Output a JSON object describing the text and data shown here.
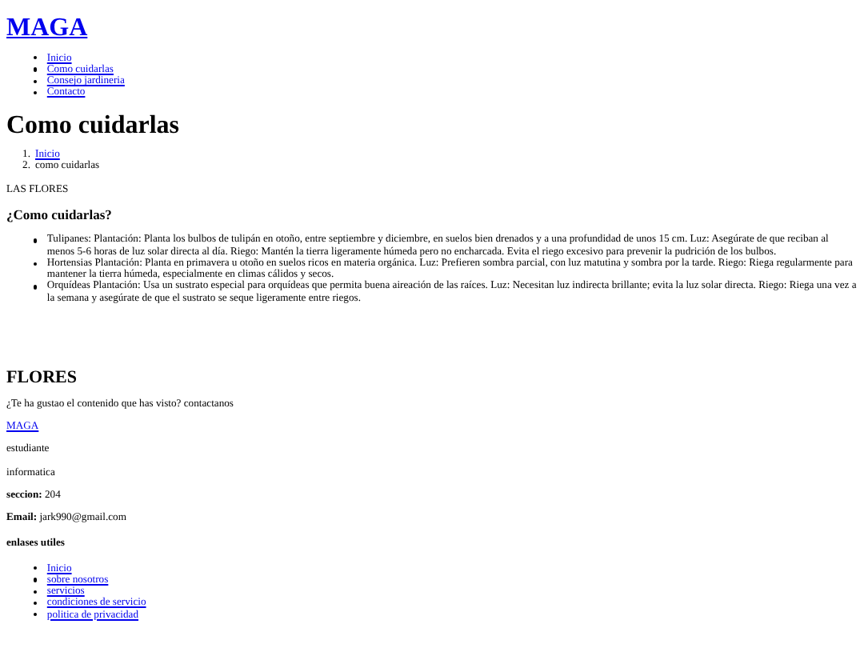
{
  "header": {
    "logo": "MAGA",
    "nav": [
      "Inicio",
      "Como cuidarlas",
      "Consejo jardineria",
      "Contacto"
    ]
  },
  "title": "Como cuidarlas",
  "breadcrumb": [
    {
      "number": "1.",
      "label": "Inicio",
      "kind": "link"
    },
    {
      "number": "2.",
      "label": "como cuidarlas",
      "kind": "text"
    }
  ],
  "section_label": "LAS FLORES",
  "subtitle": "¿Como cuidarlas?",
  "tips": [
    "Tulipanes: Plantación: Planta los bulbos de tulipán en otoño, entre septiembre y diciembre, en suelos bien drenados y a una profundidad de unos 15 cm. Luz: Asegúrate de que reciban al menos 5-6 horas de luz solar directa al día. Riego: Mantén la tierra ligeramente húmeda pero no encharcada. Evita el riego excesivo para prevenir la pudrición de los bulbos.",
    "Hortensias Plantación: Planta en primavera u otoño en suelos ricos en materia orgánica. Luz: Prefieren sombra parcial, con luz matutina y sombra por la tarde. Riego: Riega regularmente para mantener la tierra húmeda, especialmente en climas cálidos y secos.",
    "Orquídeas Plantación: Usa un sustrato especial para orquídeas que permita buena aireación de las raíces. Luz: Necesitan luz indirecta brillante; evita la luz solar directa. Riego: Riega una vez a la semana y asegúrate de que el sustrato se seque ligeramente entre riegos."
  ],
  "footer": {
    "title": "FLORES",
    "question": "¿Te ha gustao el contenido que has visto? contactanos",
    "lines": [
      {
        "kind": "link",
        "text": "MAGA"
      },
      {
        "kind": "text",
        "text": "estudiante"
      },
      {
        "kind": "text",
        "text": "informatica"
      },
      {
        "kind": "text",
        "text": "**seccion:** 204"
      },
      {
        "kind": "text",
        "text": "**Email:** jark990@gmail.com"
      }
    ],
    "links_title": "enlases utiles",
    "links": [
      "Inicio",
      "sobre nosotros",
      "servicios",
      "condiciones de servicio",
      "politica de privacidad"
    ]
  }
}
